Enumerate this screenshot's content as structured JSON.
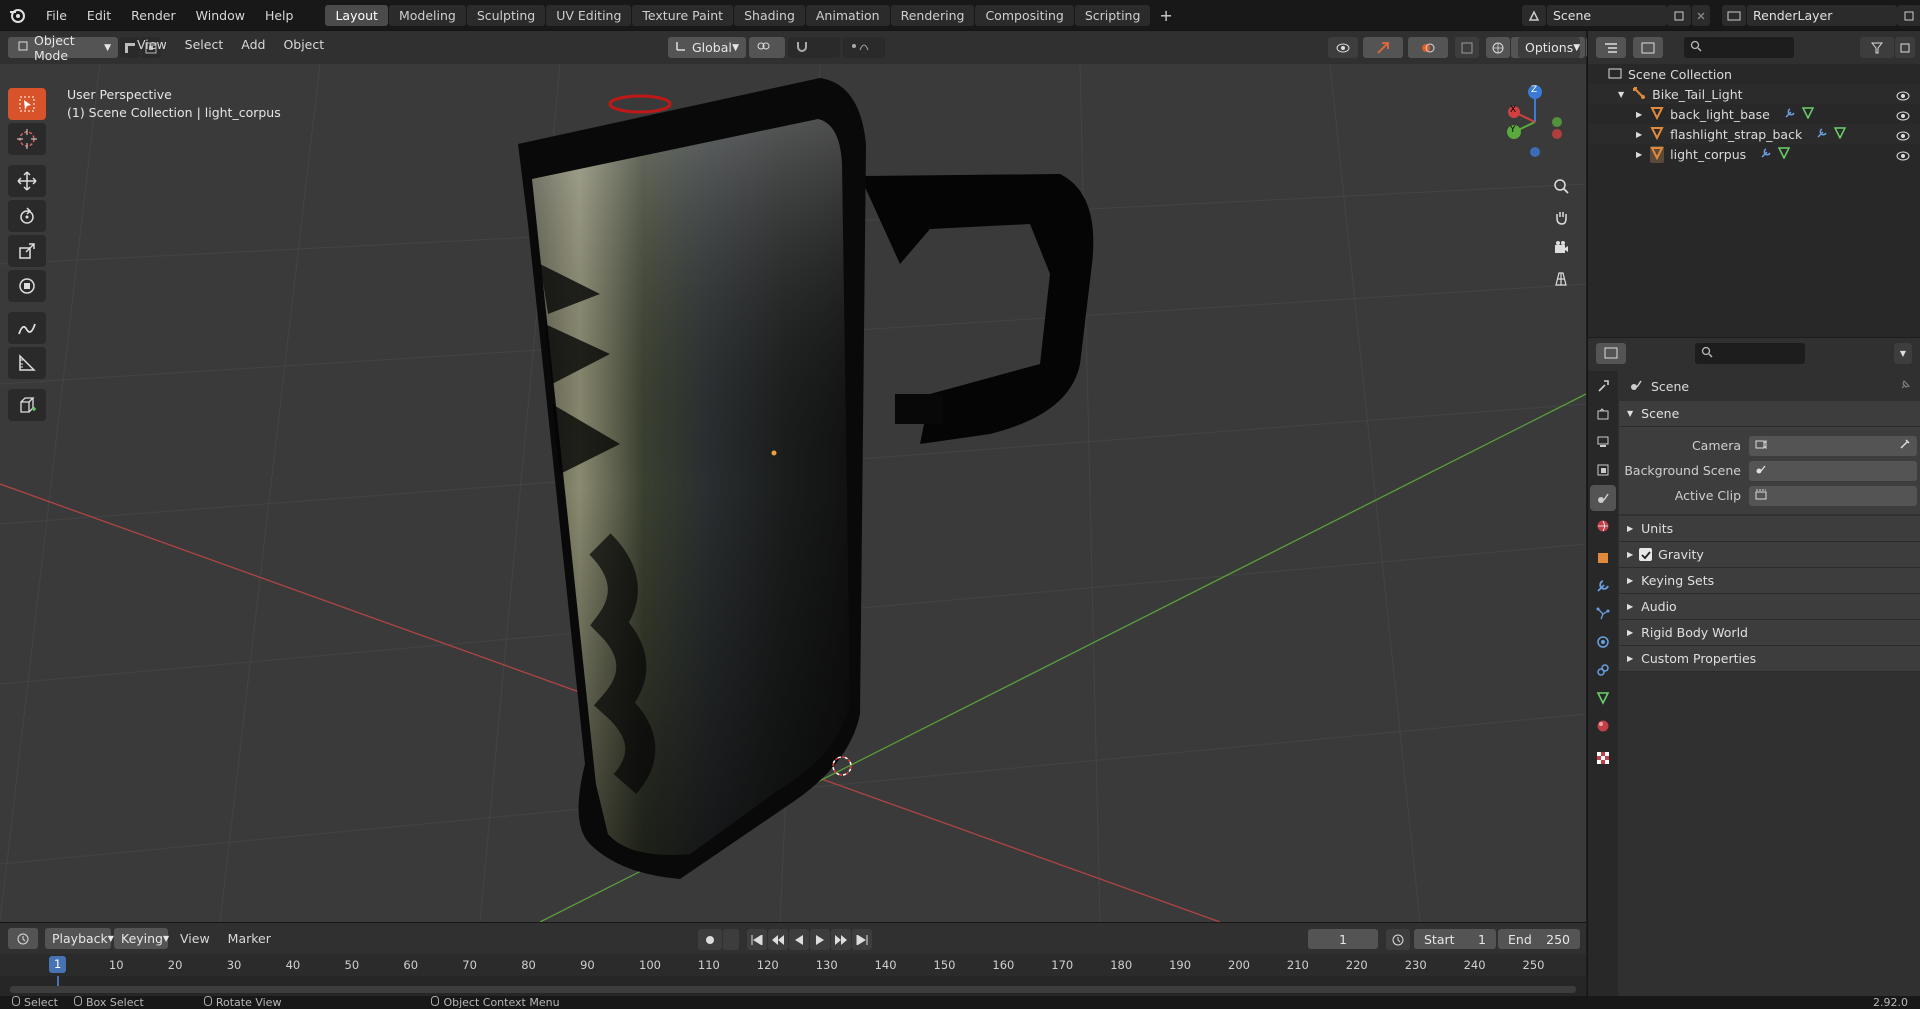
{
  "topbar": {
    "menus": [
      "File",
      "Edit",
      "Render",
      "Window",
      "Help"
    ],
    "workspaces": [
      "Layout",
      "Modeling",
      "Sculpting",
      "UV Editing",
      "Texture Paint",
      "Shading",
      "Animation",
      "Rendering",
      "Compositing",
      "Scripting"
    ],
    "active_workspace": "Layout",
    "add_workspace": "+",
    "scene_name": "Scene",
    "view_layer": "RenderLayer"
  },
  "viewport_header": {
    "mode": "Object Mode",
    "menus": [
      "View",
      "Select",
      "Add",
      "Object"
    ],
    "transform_orientation": "Global",
    "options_label": "Options"
  },
  "viewport": {
    "view_name": "User Perspective",
    "collection_info": "(1) Scene Collection | light_corpus",
    "background_color": "#3a3a3a",
    "grid_color": "#444444",
    "x_axis_color": "#b04444",
    "y_axis_color": "#5a9e3c",
    "gizmo": {
      "z": "Z",
      "y": "Y",
      "x": "X"
    }
  },
  "outliner": {
    "root": "Scene Collection",
    "collection": "Bike_Tail_Light",
    "objects": [
      "back_light_base",
      "flashlight_strap_back",
      "light_corpus"
    ]
  },
  "properties": {
    "context": "Scene",
    "panel_title": "Scene",
    "fields": [
      {
        "label": "Camera",
        "value": ""
      },
      {
        "label": "Background Scene",
        "value": ""
      },
      {
        "label": "Active Clip",
        "value": ""
      }
    ],
    "subpanels": [
      "Units",
      "Gravity",
      "Keying Sets",
      "Audio",
      "Rigid Body World",
      "Custom Properties"
    ],
    "gravity_checked": true
  },
  "timeline": {
    "menus": [
      "Playback",
      "Keying",
      "View",
      "Marker"
    ],
    "current_frame": "1",
    "start_label": "Start",
    "start": "1",
    "end_label": "End",
    "end": "250",
    "ticks": [
      "1",
      "10",
      "20",
      "30",
      "40",
      "50",
      "60",
      "70",
      "80",
      "90",
      "100",
      "110",
      "120",
      "130",
      "140",
      "150",
      "160",
      "170",
      "180",
      "190",
      "200",
      "210",
      "220",
      "230",
      "240",
      "250"
    ]
  },
  "statusbar": {
    "items": [
      "Select",
      "Box Select",
      "Rotate View",
      "Object Context Menu"
    ],
    "version": "2.92.0"
  }
}
